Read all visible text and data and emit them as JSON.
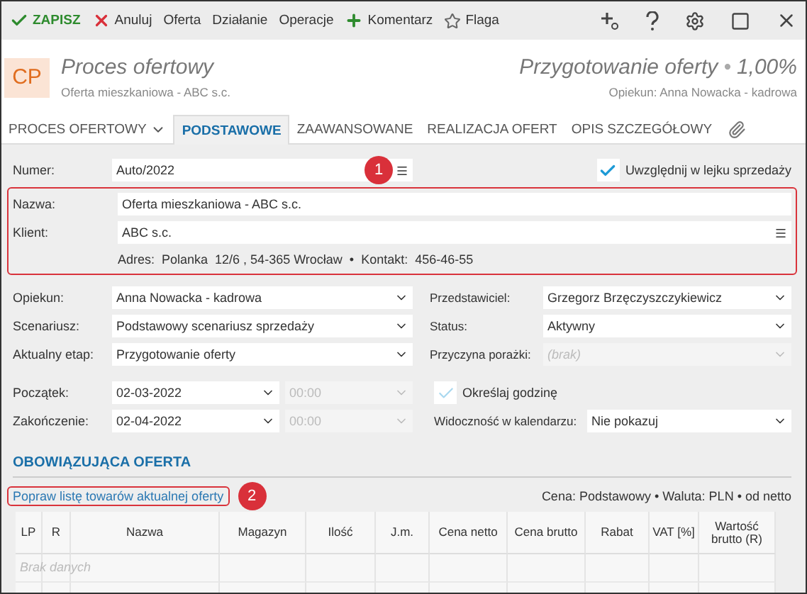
{
  "toolbar": {
    "actions": [
      {
        "label": "ZAPISZ",
        "kind": "save"
      },
      {
        "label": "Anuluj",
        "kind": "cancel"
      },
      {
        "label": "Oferta",
        "kind": "plain"
      },
      {
        "label": "Działanie",
        "kind": "plain"
      },
      {
        "label": "Operacje",
        "kind": "plain"
      },
      {
        "label": "Komentarz",
        "kind": "add"
      },
      {
        "label": "Flaga",
        "kind": "flag"
      }
    ]
  },
  "header": {
    "badge": "CP",
    "title": "Proces ofertowy",
    "subtitle": "Oferta mieszkaniowa - ABC s.c.",
    "stage": "Przygotowanie oferty",
    "separator": "•",
    "percent": "1,00%",
    "owner": "Opiekun: Anna Nowacka - kadrowa"
  },
  "tabs": [
    {
      "label": "PROCES OFERTOWY",
      "kind": "dropdown",
      "selected": false
    },
    {
      "label": "PODSTAWOWE",
      "kind": "tab",
      "selected": true
    },
    {
      "label": "ZAAWANSOWANE",
      "kind": "tab",
      "selected": false
    },
    {
      "label": "REALIZACJA OFERT",
      "kind": "tab",
      "selected": false
    },
    {
      "label": "OPIS SZCZEGÓŁOWY",
      "kind": "tab",
      "selected": false
    }
  ],
  "numer": {
    "label": "Numer:",
    "value": "Auto/2022",
    "marker": "1"
  },
  "funnel": {
    "label": "Uwzględnij w lejku sprzedaży",
    "checked": true
  },
  "client_block": {
    "highlighted": true,
    "name_label": "Nazwa:",
    "name": "Oferta mieszkaniowa - ABC s.c.",
    "client_label": "Klient:",
    "client": "ABC s.c.",
    "address": "Adres:  Polanka  12/6 , 54-365 Wrocław  •  Kontakt:  456-46-55"
  },
  "rows": [
    {
      "left": {
        "label": "Opiekun:",
        "value": "Anna Nowacka - kadrowa"
      },
      "right": {
        "label": "Przedstawiciel:",
        "value": "Grzegorz Brzęczyszczykiewicz",
        "disabled": false
      }
    },
    {
      "left": {
        "label": "Scenariusz:",
        "value": "Podstawowy scenariusz sprzedaży"
      },
      "right": {
        "label": "Status:",
        "value": "Aktywny",
        "disabled": false
      }
    },
    {
      "left": {
        "label": "Aktualny etap:",
        "value": "Przygotowanie oferty"
      },
      "right": {
        "label": "Przyczyna porażki:",
        "placeholder": "(brak)",
        "disabled": true
      }
    }
  ],
  "dates": [
    {
      "label": "Początek:",
      "date": "02-03-2022",
      "time": "00:00",
      "time_disabled": true,
      "right": {
        "kind": "checkbox",
        "label": "Określaj godzinę",
        "checked": true,
        "disabled": true
      }
    },
    {
      "label": "Zakończenie:",
      "date": "02-04-2022",
      "time": "00:00",
      "time_disabled": true,
      "right": {
        "kind": "select",
        "label": "Widoczność w kalendarzu:",
        "value": "Nie pokazuj"
      }
    }
  ],
  "section": {
    "heading": "OBOWIĄZUJĄCA OFERTA",
    "link": "Popraw listę towarów aktualnej oferty",
    "link_highlighted": true,
    "marker": "2",
    "price_info": "Cena: Podstawowy • Waluta: PLN • od netto"
  },
  "table": {
    "columns": [
      "LP",
      "R",
      "Nazwa",
      "Magazyn",
      "Ilość",
      "J.m.",
      "Cena netto",
      "Cena brutto",
      "Rabat",
      "VAT [%]",
      "Wartość brutto (R)"
    ],
    "empty_text": "Brak danych"
  }
}
